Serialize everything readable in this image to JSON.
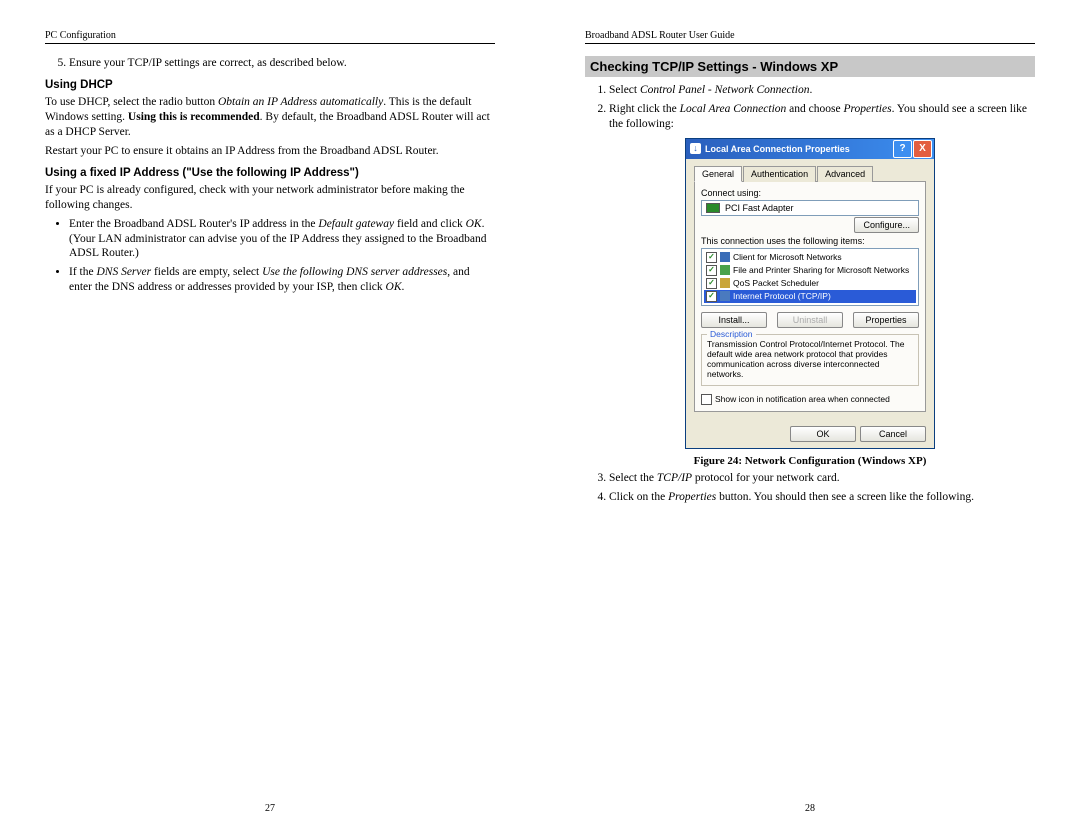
{
  "left": {
    "header": "PC Configuration",
    "page_num": "27",
    "step5": "Ensure your TCP/IP settings are correct, as described below.",
    "dhcpHeading": "Using DHCP",
    "dhcpPara1_a": "To use DHCP, select the radio button ",
    "dhcpPara1_i": "Obtain an IP Address automatically",
    "dhcpPara1_b": ". This is the default Windows setting. ",
    "dhcpPara1_bold": "Using this is recommended",
    "dhcpPara1_c": ". By default, the Broadband ADSL Router will act as a DHCP Server.",
    "dhcpPara2": "Restart your PC to ensure it obtains an IP Address from the Broadband ADSL Router.",
    "fixedHeading": "Using a fixed IP Address (\"Use the following IP Address\")",
    "fixedIntro": "If your PC is already configured, check with your network administrator before making the following changes.",
    "b1_a": "Enter the Broadband ADSL Router's IP address in the ",
    "b1_i": "Default gateway",
    "b1_b": " field and click ",
    "b1_i2": "OK",
    "b1_c": ". (Your LAN administrator can advise you of the IP Address they assigned to the Broadband ADSL Router.)",
    "b2_a": "If the ",
    "b2_i1": "DNS Server",
    "b2_b": " fields are empty, select ",
    "b2_i2": "Use the following DNS server addresses",
    "b2_c": ", and enter the DNS address or addresses provided by your ISP, then click ",
    "b2_i3": "OK",
    "b2_d": "."
  },
  "right": {
    "header": "Broadband ADSL Router User Guide",
    "page_num": "28",
    "sectionTitle": "Checking TCP/IP Settings - Windows XP",
    "s1_a": "Select ",
    "s1_i": "Control Panel - Network Connection",
    "s1_b": ".",
    "s2_a": "Right click the ",
    "s2_i": "Local Area Connection",
    "s2_b": " and choose ",
    "s2_i2": "Properties",
    "s2_c": ". You should see a screen like the following:",
    "figCaption": "Figure 24: Network Configuration (Windows XP)",
    "s3_a": "Select the ",
    "s3_i": "TCP/IP",
    "s3_b": " protocol for your network card.",
    "s4_a": "Click on the ",
    "s4_i": "Properties",
    "s4_b": " button. You should then see a screen like the following."
  },
  "xp": {
    "title": "Local Area Connection Properties",
    "tabGeneral": "General",
    "tabAuth": "Authentication",
    "tabAdv": "Advanced",
    "connectUsing": "Connect using:",
    "adapter": "PCI Fast Adapter",
    "configure": "Configure...",
    "usesItems": "This connection uses the following items:",
    "item1": "Client for Microsoft Networks",
    "item2": "File and Printer Sharing for Microsoft Networks",
    "item3": "QoS Packet Scheduler",
    "item4": "Internet Protocol (TCP/IP)",
    "install": "Install...",
    "uninstall": "Uninstall",
    "properties": "Properties",
    "descLegend": "Description",
    "descText": "Transmission Control Protocol/Internet Protocol. The default wide area network protocol that provides communication across diverse interconnected networks.",
    "notif": "Show icon in notification area when connected",
    "ok": "OK",
    "cancel": "Cancel"
  }
}
